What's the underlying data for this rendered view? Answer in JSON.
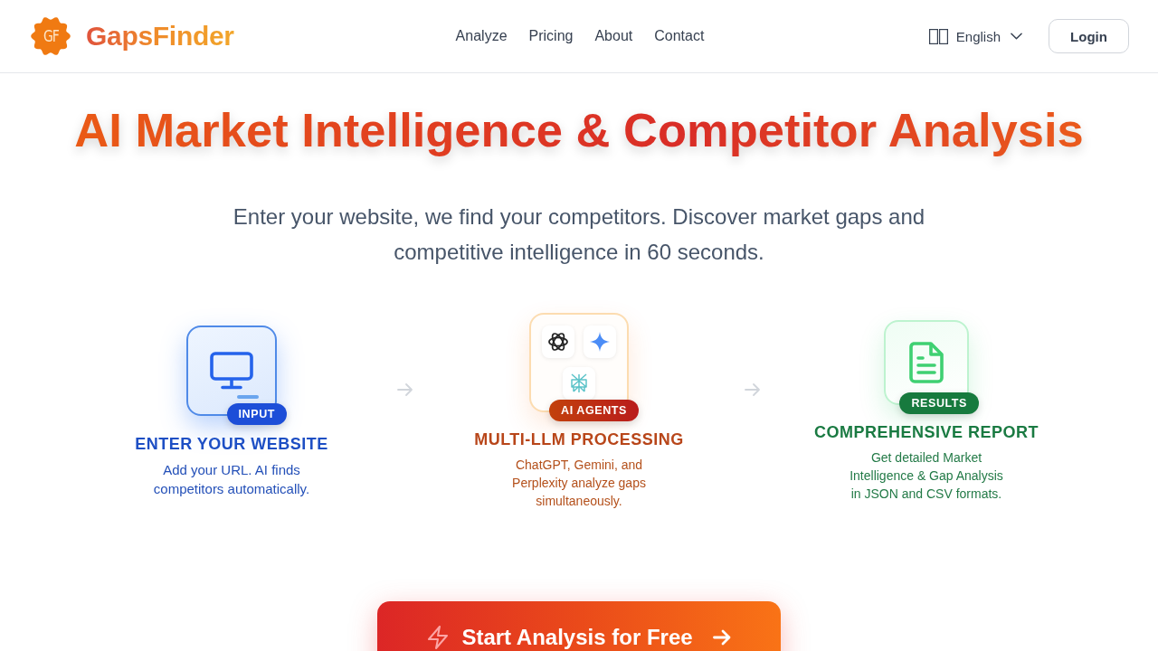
{
  "header": {
    "logo": {
      "badge": "GF",
      "name": "GapsFinder"
    },
    "nav": [
      {
        "label": "Analyze"
      },
      {
        "label": "Pricing"
      },
      {
        "label": "About"
      },
      {
        "label": "Contact"
      }
    ],
    "language": {
      "label": "English"
    },
    "login": {
      "label": "Login"
    }
  },
  "hero": {
    "title": "AI Market Intelligence & Competitor Analysis",
    "subtitle": "Enter your website, we find your competitors. Discover market gaps and competitive intelligence in 60 seconds."
  },
  "steps": [
    {
      "kind": "input",
      "badge": "INPUT",
      "title": "ENTER YOUR WEBSITE",
      "description": "Add your URL. AI finds competitors automatically."
    },
    {
      "kind": "agents",
      "badge": "AI AGENTS",
      "title": "MULTI-LLM PROCESSING",
      "description": "ChatGPT, Gemini, and Perplexity analyze gaps simultaneously."
    },
    {
      "kind": "results",
      "badge": "RESULTS",
      "title": "COMPREHENSIVE REPORT",
      "description": "Get detailed Market Intelligence & Gap Analysis in JSON and CSV formats."
    }
  ],
  "cta": {
    "label": "Start Analysis for Free"
  }
}
